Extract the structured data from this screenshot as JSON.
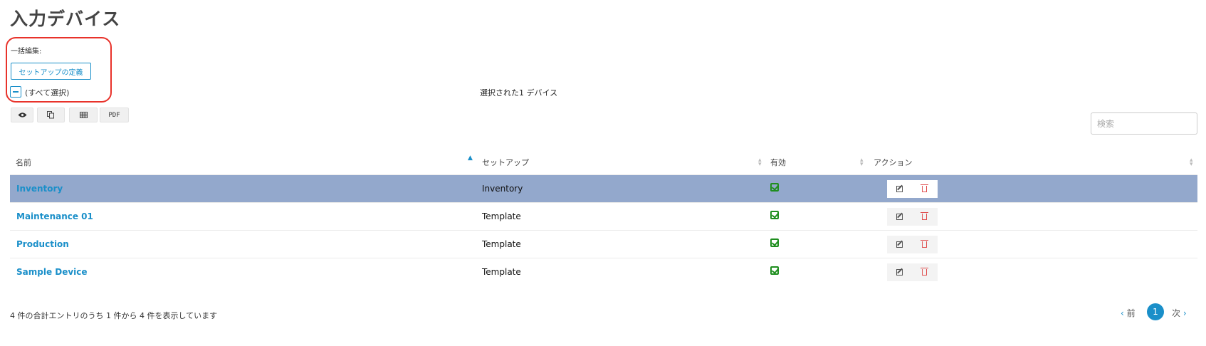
{
  "page": {
    "title": "入力デバイス"
  },
  "bulk_edit": {
    "label": "一括編集:",
    "setup_button": "セットアップの定義"
  },
  "select_all": {
    "label": "(すべて選択)"
  },
  "selection": {
    "summary": "選択された1 デバイス"
  },
  "toolbar": {
    "view_icon": "eye-icon",
    "copy_icon": "copy-icon",
    "table_icon": "table-icon",
    "pdf_label": "PDF"
  },
  "search": {
    "placeholder": "検索"
  },
  "table": {
    "headers": {
      "name": "名前",
      "setup": "セットアップ",
      "enabled": "有効",
      "action": "アクション"
    },
    "rows": [
      {
        "name": "Inventory",
        "setup": "Inventory",
        "enabled": true,
        "selected": true
      },
      {
        "name": "Maintenance 01",
        "setup": "Template",
        "enabled": true,
        "selected": false
      },
      {
        "name": "Production",
        "setup": "Template",
        "enabled": true,
        "selected": false
      },
      {
        "name": "Sample Device",
        "setup": "Template",
        "enabled": true,
        "selected": false
      }
    ]
  },
  "pagination": {
    "info": "4 件の合計エントリのうち 1 件から 4 件を表示しています",
    "prev": "前",
    "current": "1",
    "next": "次"
  },
  "colors": {
    "accent": "#1a8fc9",
    "selected_row": "#93a8cc",
    "enabled": "#1f8e1f",
    "delete": "#e05050",
    "highlight": "#e8322a"
  }
}
